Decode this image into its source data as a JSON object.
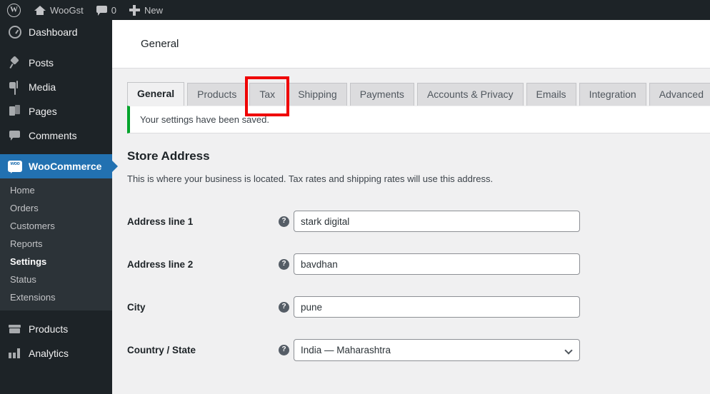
{
  "adminbar": {
    "wp_logo_icon": "wordpress-logo-icon",
    "site_name": "WooGst",
    "site_icon": "home-icon",
    "comments_icon": "comment-bubble-icon",
    "comments_count": "0",
    "new_icon": "plus-icon",
    "new_label": "New"
  },
  "sidebar": {
    "items": [
      {
        "label": "Dashboard",
        "icon": "dashboard-icon",
        "active": false
      },
      {
        "label": "Posts",
        "icon": "pin-icon",
        "active": false
      },
      {
        "label": "Media",
        "icon": "media-icon",
        "active": false
      },
      {
        "label": "Pages",
        "icon": "pages-icon",
        "active": false
      },
      {
        "label": "Comments",
        "icon": "comment-icon",
        "active": false
      },
      {
        "label": "WooCommerce",
        "icon": "woocommerce-icon",
        "active": true
      },
      {
        "label": "Products",
        "icon": "products-icon",
        "active": false
      },
      {
        "label": "Analytics",
        "icon": "analytics-icon",
        "active": false
      }
    ],
    "submenu": [
      {
        "label": "Home",
        "current": false
      },
      {
        "label": "Orders",
        "current": false
      },
      {
        "label": "Customers",
        "current": false
      },
      {
        "label": "Reports",
        "current": false
      },
      {
        "label": "Settings",
        "current": true
      },
      {
        "label": "Status",
        "current": false
      },
      {
        "label": "Extensions",
        "current": false
      }
    ],
    "active_color": "#2271b1",
    "background": "#1d2327"
  },
  "header": {
    "title": "General"
  },
  "tabs": [
    {
      "label": "General",
      "active": true,
      "highlighted": false
    },
    {
      "label": "Products",
      "active": false,
      "highlighted": false
    },
    {
      "label": "Tax",
      "active": false,
      "highlighted": true
    },
    {
      "label": "Shipping",
      "active": false,
      "highlighted": false
    },
    {
      "label": "Payments",
      "active": false,
      "highlighted": false
    },
    {
      "label": "Accounts & Privacy",
      "active": false,
      "highlighted": false
    },
    {
      "label": "Emails",
      "active": false,
      "highlighted": false
    },
    {
      "label": "Integration",
      "active": false,
      "highlighted": false
    },
    {
      "label": "Advanced",
      "active": false,
      "highlighted": false
    }
  ],
  "highlight": {
    "color": "#ef0000",
    "target": "Tax"
  },
  "notice": {
    "message": "Your settings have been saved.",
    "type": "success",
    "accent_color": "#00a32a"
  },
  "section": {
    "title": "Store Address",
    "description": "This is where your business is located. Tax rates and shipping rates will use this address.",
    "fields": [
      {
        "label": "Address line 1",
        "help_icon": "help-icon",
        "type": "text",
        "value": "stark digital",
        "placeholder": ""
      },
      {
        "label": "Address line 2",
        "help_icon": "help-icon",
        "type": "text",
        "value": "bavdhan",
        "placeholder": ""
      },
      {
        "label": "City",
        "help_icon": "help-icon",
        "type": "text",
        "value": "pune",
        "placeholder": ""
      },
      {
        "label": "Country / State",
        "help_icon": "help-icon",
        "type": "select",
        "value": "India — Maharashtra",
        "chevron_icon": "chevron-down-icon"
      }
    ]
  }
}
